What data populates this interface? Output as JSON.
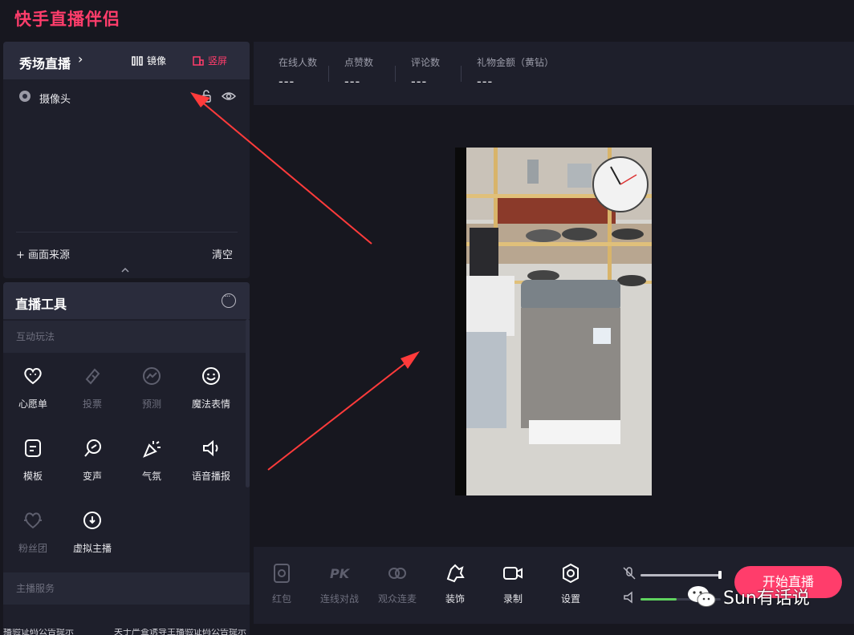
{
  "app": {
    "title": "快手直播伴侣"
  },
  "source_panel": {
    "scene_title": "秀场直播",
    "mirror_label": "镜像",
    "vertical_label": "竖屏",
    "sources": [
      {
        "label": "摄像头"
      }
    ],
    "add_source_label": "+ 画面来源",
    "clear_label": "清空"
  },
  "tools_panel": {
    "title": "直播工具",
    "section_interactive": "互动玩法",
    "section_service": "主播服务",
    "tools": [
      {
        "label": "心愿单",
        "icon": "wishlist-icon",
        "enabled": true
      },
      {
        "label": "投票",
        "icon": "vote-icon",
        "enabled": false
      },
      {
        "label": "预测",
        "icon": "predict-icon",
        "enabled": false
      },
      {
        "label": "魔法表情",
        "icon": "magic-emoji-icon",
        "enabled": true
      },
      {
        "label": "模板",
        "icon": "template-icon",
        "enabled": true
      },
      {
        "label": "变声",
        "icon": "voice-change-icon",
        "enabled": true
      },
      {
        "label": "气氛",
        "icon": "atmosphere-icon",
        "enabled": true
      },
      {
        "label": "语音播报",
        "icon": "voice-broadcast-icon",
        "enabled": true
      },
      {
        "label": "粉丝团",
        "icon": "fan-club-icon",
        "enabled": false
      },
      {
        "label": "虚拟主播",
        "icon": "virtual-host-icon",
        "enabled": true
      }
    ]
  },
  "stats": [
    {
      "label": "在线人数",
      "value": "---"
    },
    {
      "label": "点赞数",
      "value": "---"
    },
    {
      "label": "评论数",
      "value": "---"
    },
    {
      "label": "礼物金额（黄钻）",
      "value": "---"
    }
  ],
  "bottom_bar": {
    "buttons": [
      {
        "label": "红包",
        "icon": "red-packet-icon",
        "enabled": false
      },
      {
        "label": "连线对战",
        "icon": "pk-icon",
        "enabled": false
      },
      {
        "label": "观众连麦",
        "icon": "audience-link-icon",
        "enabled": false
      },
      {
        "label": "装饰",
        "icon": "decoration-icon",
        "enabled": true
      },
      {
        "label": "录制",
        "icon": "record-icon",
        "enabled": true
      },
      {
        "label": "设置",
        "icon": "settings-icon",
        "enabled": true
      }
    ],
    "mic_volume": 1.0,
    "speaker_volume": 0.45,
    "start_label": "开始直播"
  },
  "watermark": {
    "text": "Sun有话说"
  },
  "footer": {
    "left_text": "播验证码公告提示",
    "right_text": "关于严查诱导主播验证码公告提示"
  },
  "colors": {
    "accent": "#ff3d6b",
    "panel": "#1e1f2b",
    "header": "#2a2c3c",
    "background": "#17171f",
    "volume_green": "#5fd35f",
    "arrow": "#ff3b3b"
  }
}
